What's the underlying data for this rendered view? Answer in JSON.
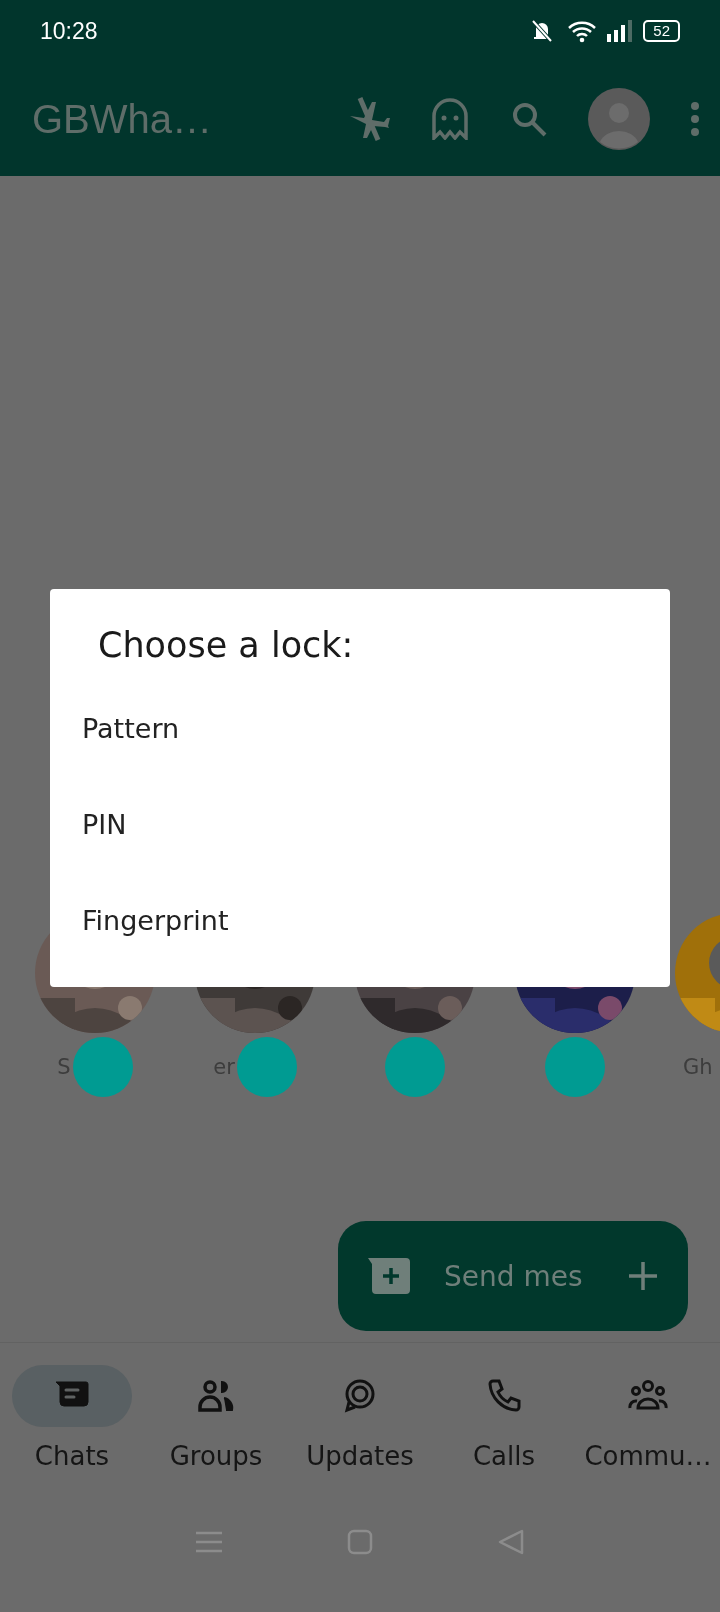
{
  "status_bar": {
    "time": "10:28",
    "battery": "52"
  },
  "app_bar": {
    "title": "GBWha…"
  },
  "statuses": [
    {
      "label": "S",
      "dot": true
    },
    {
      "label": "er",
      "dot": true
    },
    {
      "dot": true
    },
    {
      "dot": true
    },
    {
      "label": "Gh",
      "dot": false
    }
  ],
  "fab": {
    "label": "Send mes"
  },
  "tabs": [
    {
      "label": "Chats",
      "selected": true
    },
    {
      "label": "Groups",
      "selected": false
    },
    {
      "label": "Updates",
      "selected": false
    },
    {
      "label": "Calls",
      "selected": false
    },
    {
      "label": "Commu…",
      "selected": false
    }
  ],
  "dialog": {
    "title": "Choose a lock:",
    "options": [
      "Pattern",
      "PIN",
      "Fingerprint"
    ]
  }
}
